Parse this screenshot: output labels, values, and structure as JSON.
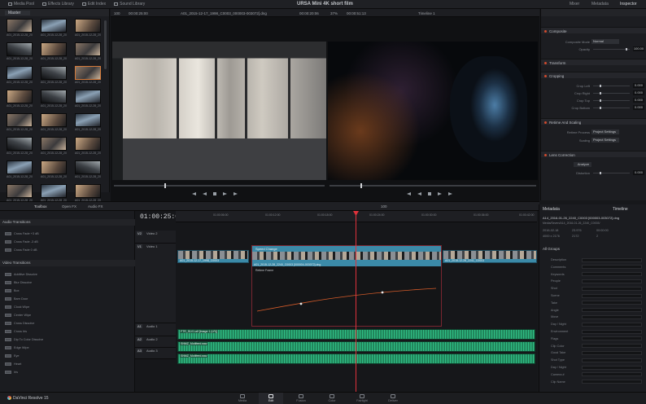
{
  "topbar": {
    "media_pool": "Media Pool",
    "effects_library": "Effects Library",
    "edit_index": "Edit Index",
    "sound_library": "Sound Library",
    "title": "URSA Mini 4K short film",
    "mixer": "Mixer",
    "metadata": "Metadata",
    "inspector": "Inspector"
  },
  "media": {
    "bin": "Master",
    "clip_label": "A01_2015-12-28_200..."
  },
  "viewer": {
    "source_zoom": "100",
    "source_tc": "00:00:20:06",
    "source_clip": "A01_2015-12-17_1998_C0003_000003-003072].dng",
    "source_dur": "00:00:25:00",
    "program_zoom": "37%",
    "program_tc": "00:00:51:13",
    "program_clip": "Timeline 1"
  },
  "inspector": {
    "composite": "Composite",
    "composite_mode_label": "Composite Mode",
    "composite_mode": "Normal",
    "opacity_label": "Opacity",
    "opacity": "100.00",
    "transform": "Transform",
    "cropping": "Cropping",
    "crop_left": "Crop Left",
    "crop_right": "Crop Right",
    "crop_top": "Crop Top",
    "crop_bottom": "Crop Bottom",
    "crop_value": "0.000",
    "retime": "Retime And Scaling",
    "retime_process_label": "Retime Process",
    "retime_process": "Project Settings",
    "scaling_label": "Scaling",
    "scaling": "Project Settings",
    "lens": "Lens Correction",
    "analyze": "Analyze",
    "distortion_label": "Distortion",
    "distortion": "0.000"
  },
  "edit": {
    "toolbox": "Toolbox",
    "open_fx": "Open FX",
    "audio_fx": "Audio FX",
    "timecode": "01:00:25:09",
    "zoom_value": "100"
  },
  "effects": {
    "audio_transitions": "Audio Transitions",
    "audio_items": [
      "Cross Fade +3 dB",
      "Cross Fade -3 dB",
      "Cross Fade 0 dB"
    ],
    "video_transitions": "Video Transitions",
    "video_items": [
      "Additive Dissolve",
      "Blur Dissolve",
      "Box",
      "Barn Door",
      "Clock Wipe",
      "Center Wipe",
      "Cross Dissolve",
      "Cross Iris",
      "Dip To Color Dissolve",
      "Edge Wipe",
      "Eye",
      "Heart",
      "Iris"
    ]
  },
  "timeline": {
    "ruler": [
      "01:00:06:00",
      "01:00:12:00",
      "01:00:18:00",
      "01:00:24:00",
      "01:00:30:00",
      "01:00:36:00",
      "01:00:42:00"
    ],
    "video2": "Video 2",
    "video1": "Video 1",
    "audio1": "Audio 1",
    "audio2": "Audio 2",
    "audio3": "Audio 3",
    "v1_clips": [
      "A01_2015-12-17_1998_C0003",
      "A01_2015-12-28_2240_C0003 [000004-003072].dng",
      "A01_2015-12-28_2241_C0003"
    ],
    "speed_change": "Speed Change",
    "retime_frame": "Retime Frame",
    "a1_clip": "FTR_SLV1.aif [Image 1 (LR)]",
    "a2_clip": "SNMZ_Motifeed.wav",
    "a3_clip": "SNMZ_Motifeed.wav"
  },
  "metadata": {
    "title": "Metadata",
    "timeline_tab": "Timeline",
    "clip": "A14_2016-01-26_2240_C0003 [000003-003072].dng",
    "path": "Media/Seven/A14_2016-01-26_2240_C0003/",
    "date": "2016-02-18",
    "res": "4000 x 2176",
    "fps": "23.976",
    "codec": "2172",
    "frames": "00:00:00",
    "count": "2",
    "all_groups": "All Groups",
    "fields": [
      "Description",
      "Comments",
      "Keywords",
      "People",
      "Shot",
      "Scene",
      "Take",
      "Angle",
      "Move",
      "Day / Night",
      "Environment",
      "Flags",
      "Clip Color",
      "Good Take",
      "Shot Type",
      "Day / Night",
      "Camera #",
      "Clip Name"
    ]
  },
  "pages": [
    "Media",
    "Edit",
    "Fusion",
    "Color",
    "Fairlight",
    "Deliver"
  ],
  "brand": "DaVinci Resolve 15"
}
